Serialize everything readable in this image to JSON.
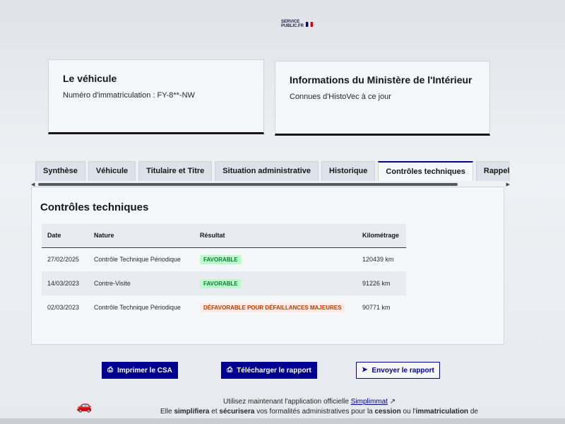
{
  "logo": {
    "line1": "SERVICE",
    "line2": "PUBLIC.FR"
  },
  "vehicle_card": {
    "title": "Le véhicule",
    "text": "Numéro d'immatriculation : FY-8**-NW"
  },
  "info_card": {
    "title": "Informations du Ministère de l'Intérieur",
    "text": "Connues d'HistoVec à ce jour"
  },
  "tabs": [
    {
      "label": "Synthèse"
    },
    {
      "label": "Véhicule"
    },
    {
      "label": "Titulaire et Titre"
    },
    {
      "label": "Situation administrative"
    },
    {
      "label": "Historique"
    },
    {
      "label": "Contrôles techniques"
    },
    {
      "label": "Rappels constructeur"
    }
  ],
  "active_tab": "Contrôles techniques",
  "panel": {
    "title": "Contrôles techniques",
    "columns": [
      "Date",
      "Nature",
      "Résultat",
      "Kilométrage"
    ],
    "rows": [
      {
        "date": "27/02/2025",
        "nature": "Contrôle Technique Périodique",
        "result": "FAVORABLE",
        "km": "120439 km"
      },
      {
        "date": "14/03/2023",
        "nature": "Contre-Visite",
        "result": "FAVORABLE",
        "km": "91226 km"
      },
      {
        "date": "02/03/2023",
        "nature": "Contrôle Technique Périodique",
        "result": "DÉFAVORABLE POUR DÉFAILLANCES MAJEURES",
        "km": "90771 km"
      }
    ]
  },
  "buttons": {
    "print": "Imprimer le CSA",
    "download": "Télécharger le rapport",
    "send": "Envoyer le rapport"
  },
  "footer": {
    "line1_prefix": "Utilisez maintenant l'application officielle",
    "line1_link": "Simplimmat",
    "line2_a": "Elle ",
    "line2_b": "simplifiera",
    "line2_c": " et ",
    "line2_d": "sécurisera",
    "line2_e": " vos formalités administratives pour la ",
    "line2_f": "cession",
    "line2_g": " ou l'",
    "line2_h": "immatriculation",
    "line2_i": " de"
  },
  "colors": {
    "primary": "#000091",
    "success": "#18753c",
    "error": "#b34000"
  }
}
